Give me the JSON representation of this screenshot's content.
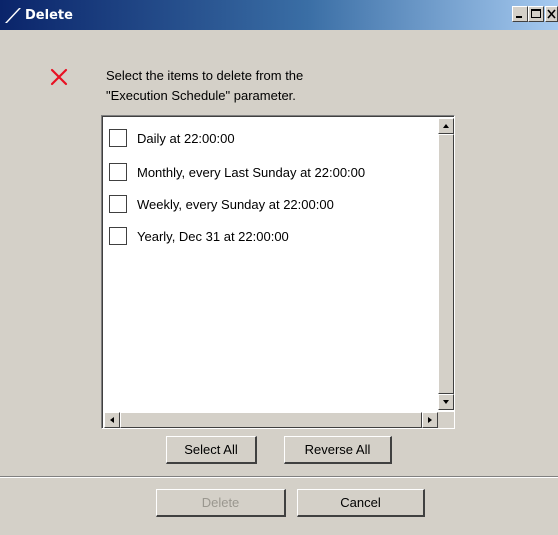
{
  "window": {
    "title": "Delete",
    "controls": {
      "minimize": "minimize",
      "maximize": "maximize",
      "close": "close"
    }
  },
  "message": {
    "icon": "red-x-icon",
    "text": "Select the items to delete from the\n\"Execution Schedule\" parameter."
  },
  "list": {
    "items": [
      {
        "label": "Daily at 22:00:00",
        "checked": false
      },
      {
        "label": "Monthly, every Last Sunday at 22:00:00",
        "checked": false
      },
      {
        "label": "Weekly, every Sunday at 22:00:00",
        "checked": false
      },
      {
        "label": "Yearly, Dec 31 at 22:00:00",
        "checked": false
      }
    ]
  },
  "buttons": {
    "select_all": "Select All",
    "reverse_all": "Reverse All",
    "delete": "Delete",
    "cancel": "Cancel"
  },
  "colors": {
    "title_gradient_start": "#0a246a",
    "title_gradient_end": "#a6caf0",
    "dialog_bg": "#d4d0c8",
    "error_icon": "#e81123",
    "disabled_text": "#9a978f"
  }
}
